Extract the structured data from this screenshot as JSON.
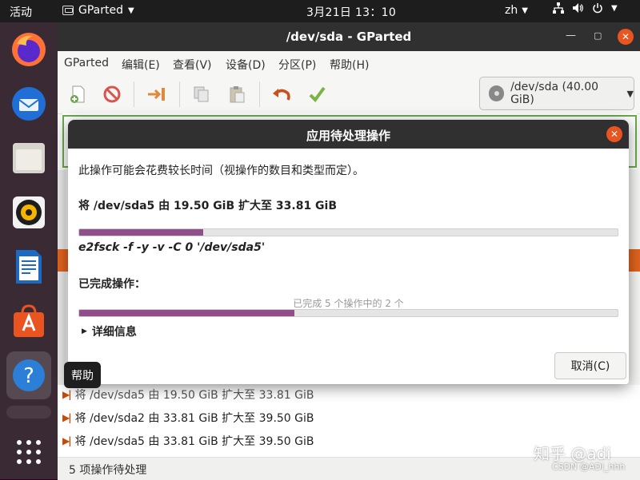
{
  "topbar": {
    "activities": "活动",
    "app_name": "GParted",
    "clock": "3月21日  13：10",
    "lang": "zh",
    "tray_icons": [
      "network-icon",
      "volume-icon",
      "power-icon"
    ]
  },
  "dock": {
    "apps": [
      "firefox",
      "thunderbird",
      "files",
      "rhythmbox",
      "libreoffice-writer",
      "ubuntu-software",
      "help"
    ],
    "tooltip": "帮助"
  },
  "window": {
    "title": "/dev/sda - GParted",
    "menu": [
      "GParted",
      "编辑(E)",
      "查看(V)",
      "设备(D)",
      "分区(P)",
      "帮助(H)"
    ],
    "device_selector": "/dev/sda (40.00 GiB)",
    "pending_ops": [
      "将 /dev/sda5 由 19.50 GiB 扩大至 33.81 GiB",
      "将 /dev/sda2 由 33.81 GiB 扩大至 39.50 GiB",
      "将 /dev/sda5 由 33.81 GiB 扩大至 39.50 GiB"
    ],
    "status": "5 项操作待处理"
  },
  "dialog": {
    "title": "应用待处理操作",
    "intro": "此操作可能会花费较长时间（视操作的数目和类型而定）。",
    "current_op": "将 /dev/sda5 由 19.50 GiB 扩大至 33.81 GiB",
    "current_progress": 0.23,
    "command": "e2fsck -f -y -v -C 0 '/dev/sda5'",
    "completed_label": "已完成操作：",
    "completed_text": "已完成 5 个操作中的 2 个",
    "completed_progress": 0.4,
    "details_label": "详细信息",
    "cancel_label": "取消(C)"
  },
  "watermark": {
    "main": "知乎 @adi",
    "sub": "CSDN @ADi_hhh"
  },
  "colors": {
    "accent": "#e95420",
    "progress": "#924d8b",
    "titlebar": "#303030"
  }
}
